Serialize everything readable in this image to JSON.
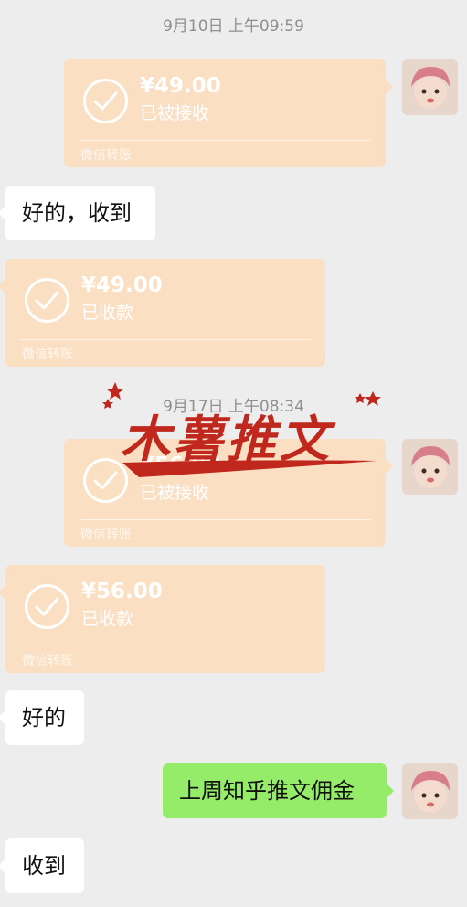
{
  "messages": {
    "timestamp1": "9月10日 上午09:59",
    "transfer1": {
      "amount": "¥49.00",
      "status": "已被接收",
      "label": "微信转账"
    },
    "text1": "好的，收到",
    "transfer2": {
      "amount": "¥49.00",
      "status": "已收款",
      "label": "微信转账"
    },
    "timestamp2": "9月17日 上午08:34",
    "transfer3": {
      "amount": "¥56.00",
      "status": "已被接收",
      "label": "微信转账"
    },
    "transfer4": {
      "amount": "¥56.00",
      "status": "已收款",
      "label": "微信转账"
    },
    "text2": "好的",
    "text3": "上周知乎推文佣金",
    "text4": "收到"
  },
  "watermark": {
    "text": "木薯推文"
  },
  "colors": {
    "background": "#ededed",
    "transfer": "#fadfc2",
    "sent_bubble": "#95ec69",
    "watermark": "#c0271d"
  },
  "icons": [
    "check-circle-icon",
    "avatar",
    "star-icon"
  ]
}
